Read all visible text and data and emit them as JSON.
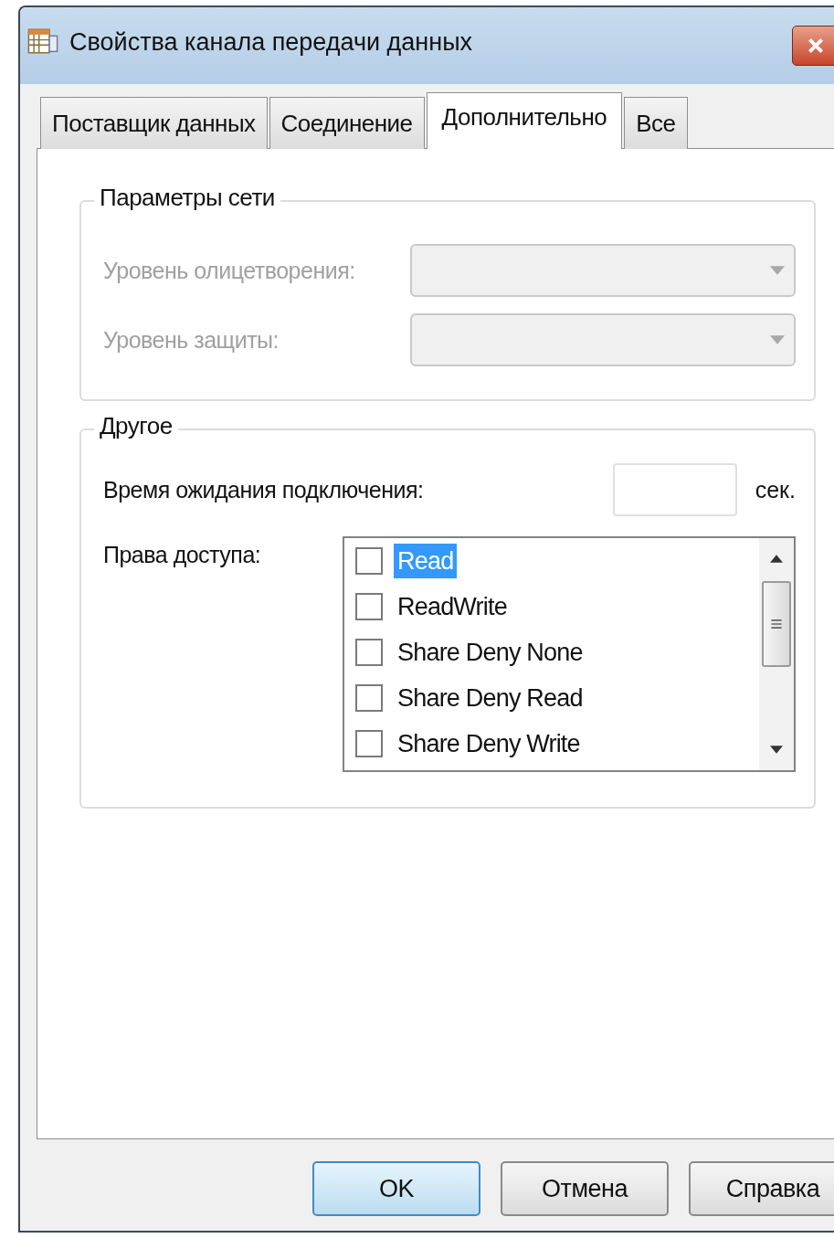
{
  "window": {
    "title": "Свойства канала передачи данных"
  },
  "tabs": [
    {
      "label": "Поставщик данных",
      "selected": false
    },
    {
      "label": "Соединение",
      "selected": false
    },
    {
      "label": "Дополнительно",
      "selected": true
    },
    {
      "label": "Все",
      "selected": false
    }
  ],
  "network_group": {
    "title": "Параметры сети",
    "fields": [
      {
        "label": "Уровень олицетворения:",
        "disabled": true
      },
      {
        "label": "Уровень защиты:",
        "disabled": true
      }
    ]
  },
  "other_group": {
    "title": "Другое",
    "timeout": {
      "label": "Время ожидания подключения:",
      "unit": "сек."
    },
    "access": {
      "label": "Права доступа:",
      "items": [
        {
          "label": "Read",
          "checked": false,
          "selected": true
        },
        {
          "label": "ReadWrite",
          "checked": false,
          "selected": false
        },
        {
          "label": "Share Deny None",
          "checked": false,
          "selected": false
        },
        {
          "label": "Share Deny Read",
          "checked": false,
          "selected": false
        },
        {
          "label": "Share Deny Write",
          "checked": false,
          "selected": false
        }
      ]
    }
  },
  "buttons": [
    {
      "label": "OK",
      "default": true
    },
    {
      "label": "Отмена",
      "default": false
    },
    {
      "label": "Справка",
      "default": false
    }
  ]
}
